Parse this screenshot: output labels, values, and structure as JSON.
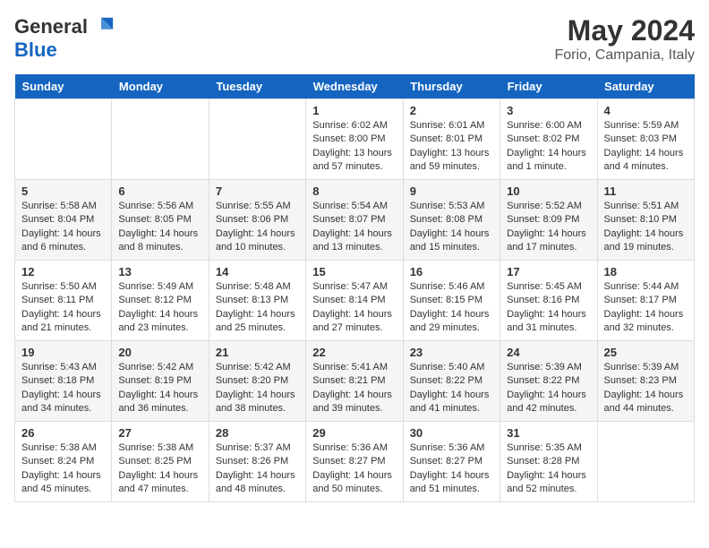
{
  "logo": {
    "general": "General",
    "blue": "Blue"
  },
  "header": {
    "month_year": "May 2024",
    "location": "Forio, Campania, Italy"
  },
  "weekdays": [
    "Sunday",
    "Monday",
    "Tuesday",
    "Wednesday",
    "Thursday",
    "Friday",
    "Saturday"
  ],
  "weeks": [
    [
      {
        "day": "",
        "info": ""
      },
      {
        "day": "",
        "info": ""
      },
      {
        "day": "",
        "info": ""
      },
      {
        "day": "1",
        "info": "Sunrise: 6:02 AM\nSunset: 8:00 PM\nDaylight: 13 hours and 57 minutes."
      },
      {
        "day": "2",
        "info": "Sunrise: 6:01 AM\nSunset: 8:01 PM\nDaylight: 13 hours and 59 minutes."
      },
      {
        "day": "3",
        "info": "Sunrise: 6:00 AM\nSunset: 8:02 PM\nDaylight: 14 hours and 1 minute."
      },
      {
        "day": "4",
        "info": "Sunrise: 5:59 AM\nSunset: 8:03 PM\nDaylight: 14 hours and 4 minutes."
      }
    ],
    [
      {
        "day": "5",
        "info": "Sunrise: 5:58 AM\nSunset: 8:04 PM\nDaylight: 14 hours and 6 minutes."
      },
      {
        "day": "6",
        "info": "Sunrise: 5:56 AM\nSunset: 8:05 PM\nDaylight: 14 hours and 8 minutes."
      },
      {
        "day": "7",
        "info": "Sunrise: 5:55 AM\nSunset: 8:06 PM\nDaylight: 14 hours and 10 minutes."
      },
      {
        "day": "8",
        "info": "Sunrise: 5:54 AM\nSunset: 8:07 PM\nDaylight: 14 hours and 13 minutes."
      },
      {
        "day": "9",
        "info": "Sunrise: 5:53 AM\nSunset: 8:08 PM\nDaylight: 14 hours and 15 minutes."
      },
      {
        "day": "10",
        "info": "Sunrise: 5:52 AM\nSunset: 8:09 PM\nDaylight: 14 hours and 17 minutes."
      },
      {
        "day": "11",
        "info": "Sunrise: 5:51 AM\nSunset: 8:10 PM\nDaylight: 14 hours and 19 minutes."
      }
    ],
    [
      {
        "day": "12",
        "info": "Sunrise: 5:50 AM\nSunset: 8:11 PM\nDaylight: 14 hours and 21 minutes."
      },
      {
        "day": "13",
        "info": "Sunrise: 5:49 AM\nSunset: 8:12 PM\nDaylight: 14 hours and 23 minutes."
      },
      {
        "day": "14",
        "info": "Sunrise: 5:48 AM\nSunset: 8:13 PM\nDaylight: 14 hours and 25 minutes."
      },
      {
        "day": "15",
        "info": "Sunrise: 5:47 AM\nSunset: 8:14 PM\nDaylight: 14 hours and 27 minutes."
      },
      {
        "day": "16",
        "info": "Sunrise: 5:46 AM\nSunset: 8:15 PM\nDaylight: 14 hours and 29 minutes."
      },
      {
        "day": "17",
        "info": "Sunrise: 5:45 AM\nSunset: 8:16 PM\nDaylight: 14 hours and 31 minutes."
      },
      {
        "day": "18",
        "info": "Sunrise: 5:44 AM\nSunset: 8:17 PM\nDaylight: 14 hours and 32 minutes."
      }
    ],
    [
      {
        "day": "19",
        "info": "Sunrise: 5:43 AM\nSunset: 8:18 PM\nDaylight: 14 hours and 34 minutes."
      },
      {
        "day": "20",
        "info": "Sunrise: 5:42 AM\nSunset: 8:19 PM\nDaylight: 14 hours and 36 minutes."
      },
      {
        "day": "21",
        "info": "Sunrise: 5:42 AM\nSunset: 8:20 PM\nDaylight: 14 hours and 38 minutes."
      },
      {
        "day": "22",
        "info": "Sunrise: 5:41 AM\nSunset: 8:21 PM\nDaylight: 14 hours and 39 minutes."
      },
      {
        "day": "23",
        "info": "Sunrise: 5:40 AM\nSunset: 8:22 PM\nDaylight: 14 hours and 41 minutes."
      },
      {
        "day": "24",
        "info": "Sunrise: 5:39 AM\nSunset: 8:22 PM\nDaylight: 14 hours and 42 minutes."
      },
      {
        "day": "25",
        "info": "Sunrise: 5:39 AM\nSunset: 8:23 PM\nDaylight: 14 hours and 44 minutes."
      }
    ],
    [
      {
        "day": "26",
        "info": "Sunrise: 5:38 AM\nSunset: 8:24 PM\nDaylight: 14 hours and 45 minutes."
      },
      {
        "day": "27",
        "info": "Sunrise: 5:38 AM\nSunset: 8:25 PM\nDaylight: 14 hours and 47 minutes."
      },
      {
        "day": "28",
        "info": "Sunrise: 5:37 AM\nSunset: 8:26 PM\nDaylight: 14 hours and 48 minutes."
      },
      {
        "day": "29",
        "info": "Sunrise: 5:36 AM\nSunset: 8:27 PM\nDaylight: 14 hours and 50 minutes."
      },
      {
        "day": "30",
        "info": "Sunrise: 5:36 AM\nSunset: 8:27 PM\nDaylight: 14 hours and 51 minutes."
      },
      {
        "day": "31",
        "info": "Sunrise: 5:35 AM\nSunset: 8:28 PM\nDaylight: 14 hours and 52 minutes."
      },
      {
        "day": "",
        "info": ""
      }
    ]
  ]
}
